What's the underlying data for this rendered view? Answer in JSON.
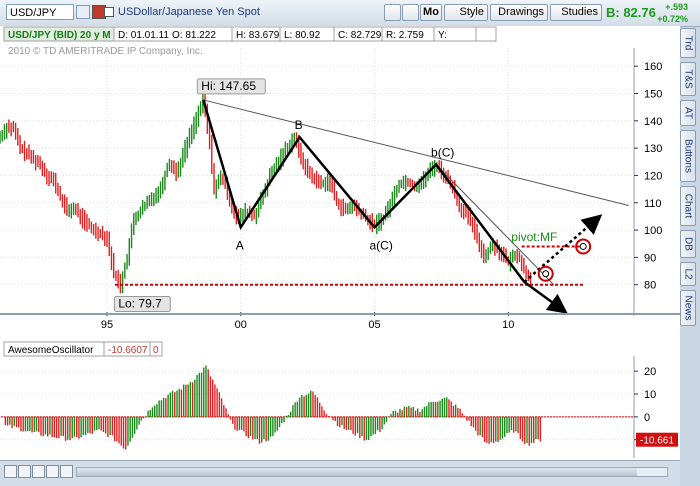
{
  "toolbar": {
    "symbol": "USD/JPY",
    "description": "USDollar/Japanese Yen Spot",
    "mo_label": "Mo",
    "style_label": "Style",
    "drawings_label": "Drawings",
    "studies_label": "Studies",
    "bid_label": "B: 82.76",
    "change_abs": "+.593",
    "change_pct": "+0.72%"
  },
  "info_bar": {
    "title": "USD/JPY (BID) 20 y M",
    "date": "D: 01.01.11",
    "open": "O: 81.222",
    "high": "H: 83.679",
    "low": "L: 80.92",
    "close": "C: 82.729",
    "range": "R: 2.759",
    "y": "Y:"
  },
  "copyright": "2010 © TD AMERITRADE IP Company, Inc.",
  "sidebar": {
    "tabs": [
      {
        "label": "Trd"
      },
      {
        "label": "T&S"
      },
      {
        "label": "AT"
      },
      {
        "label": "Buttons"
      },
      {
        "label": "Chart"
      },
      {
        "label": "DB"
      },
      {
        "label": "L2"
      },
      {
        "label": "News"
      }
    ]
  },
  "chart_data": [
    {
      "type": "line",
      "title": "USD/JPY (BID) 20 y M",
      "xlabel": "",
      "ylabel": "",
      "x_ticks": [
        "95",
        "00",
        "05",
        "10"
      ],
      "x_tick_years": [
        1995,
        2000,
        2005,
        2010
      ],
      "y_ticks": [
        80,
        90,
        100,
        110,
        120,
        130,
        140,
        150,
        160
      ],
      "ylim": [
        70,
        163
      ],
      "xlim": [
        1991.0,
        2014.7
      ],
      "series": [
        {
          "x": [
            1991.0,
            1991.25,
            1991.5,
            1991.75,
            1992.0,
            1992.25,
            1992.5,
            1992.75,
            1993.0,
            1993.25,
            1993.5,
            1993.75,
            1994.0,
            1994.25,
            1994.5,
            1994.75,
            1995.0,
            1995.25,
            1995.5,
            1995.75,
            1996.0,
            1996.5,
            1997.0,
            1997.3,
            1997.6,
            1998.0,
            1998.3,
            1998.6,
            1998.8,
            1999.0,
            1999.3,
            1999.6,
            1999.9,
            2000.2,
            2000.5,
            2000.8,
            2001.1,
            2001.4,
            2001.7,
            2002.0,
            2002.2,
            2002.4,
            2002.7,
            2003.0,
            2003.3,
            2003.6,
            2003.9,
            2004.2,
            2004.5,
            2004.8,
            2005.0,
            2005.3,
            2005.6,
            2005.9,
            2006.2,
            2006.5,
            2006.8,
            2007.1,
            2007.3,
            2007.6,
            2007.9,
            2008.2,
            2008.5,
            2008.8,
            2009.1,
            2009.4,
            2009.7,
            2010.0,
            2010.3,
            2010.6,
            2010.9
          ],
          "y": [
            134,
            138,
            137,
            130,
            128,
            126,
            124,
            120,
            118,
            112,
            107,
            108,
            105,
            102,
            100,
            99,
            97,
            84,
            80,
            90,
            104,
            110,
            115,
            125,
            121,
            132,
            140,
            147.65,
            135,
            115,
            120,
            110,
            104,
            107,
            105,
            112,
            120,
            125,
            130,
            134,
            128,
            123,
            119,
            117,
            118,
            110,
            107,
            109,
            106,
            103,
            102,
            104,
            110,
            117,
            118,
            116,
            118,
            122,
            124,
            120,
            116,
            108,
            105,
            98,
            90,
            95,
            92,
            88,
            92,
            85,
            82
          ]
        }
      ],
      "annotations": [
        {
          "label": "Hi: 147.65",
          "x": 1998.6,
          "y": 147.65
        },
        {
          "label": "Lo: 79.7",
          "x": 1995.5,
          "y": 79.7
        },
        {
          "label": "A",
          "x": 2000.0,
          "y": 101
        },
        {
          "label": "B",
          "x": 2002.2,
          "y": 134
        },
        {
          "label": "a(C)",
          "x": 2005.0,
          "y": 101
        },
        {
          "label": "b(C)",
          "x": 2007.3,
          "y": 124
        },
        {
          "label": "pivot:MF",
          "x": 2010.3,
          "y": 96
        }
      ],
      "support_level": 80,
      "pivot_level": 94,
      "elliott_wave": {
        "x": [
          1998.6,
          2000.0,
          2002.2,
          2005.0,
          2007.3,
          2010.6
        ],
        "y": [
          147.65,
          101,
          134,
          101,
          124,
          81
        ]
      },
      "trendline": {
        "x": [
          1998.6,
          2014.5
        ],
        "y": [
          147.65,
          109
        ]
      },
      "channel_line": {
        "x": [
          2007.3,
          2011.7
        ],
        "y": [
          124,
          80
        ]
      },
      "projection_down": {
        "x": [
          2010.6,
          2012.0
        ],
        "y": [
          81,
          71
        ]
      },
      "projection_up": {
        "x": [
          2010.6,
          2013.3
        ],
        "y": [
          81,
          104
        ]
      },
      "circles": [
        {
          "x": 2011.4,
          "y": 84
        },
        {
          "x": 2012.8,
          "y": 94
        }
      ]
    },
    {
      "type": "bar",
      "title": "AwesomeOscillator",
      "value_label": "-10.6607",
      "extra_label": "0",
      "y_ticks": [
        20,
        10,
        0,
        -10
      ],
      "ylim": [
        -18,
        24
      ],
      "xlim": [
        1991.0,
        2014.7
      ],
      "current_value": "-10.661",
      "x": [
        1991.2,
        1991.7,
        1992.2,
        1992.7,
        1993.2,
        1993.7,
        1994.2,
        1994.7,
        1995.2,
        1995.7,
        1996.2,
        1996.7,
        1997.2,
        1997.7,
        1998.2,
        1998.7,
        1999.2,
        1999.7,
        2000.2,
        2000.7,
        2001.2,
        2001.7,
        2002.2,
        2002.7,
        2003.2,
        2003.7,
        2004.2,
        2004.7,
        2005.2,
        2005.7,
        2006.2,
        2006.7,
        2007.2,
        2007.7,
        2008.2,
        2008.7,
        2009.2,
        2009.7,
        2010.2,
        2010.7,
        2011.2
      ],
      "values": [
        -4,
        -5,
        -7,
        -8,
        -9,
        -10,
        -8,
        -6,
        -9,
        -14,
        -3,
        5,
        9,
        12,
        16,
        22,
        10,
        -4,
        -8,
        -11,
        -9,
        0,
        9,
        11,
        2,
        -4,
        -7,
        -10,
        -6,
        2,
        4,
        3,
        7,
        8,
        3,
        -5,
        -12,
        -10,
        -6,
        -12,
        -10
      ]
    }
  ]
}
